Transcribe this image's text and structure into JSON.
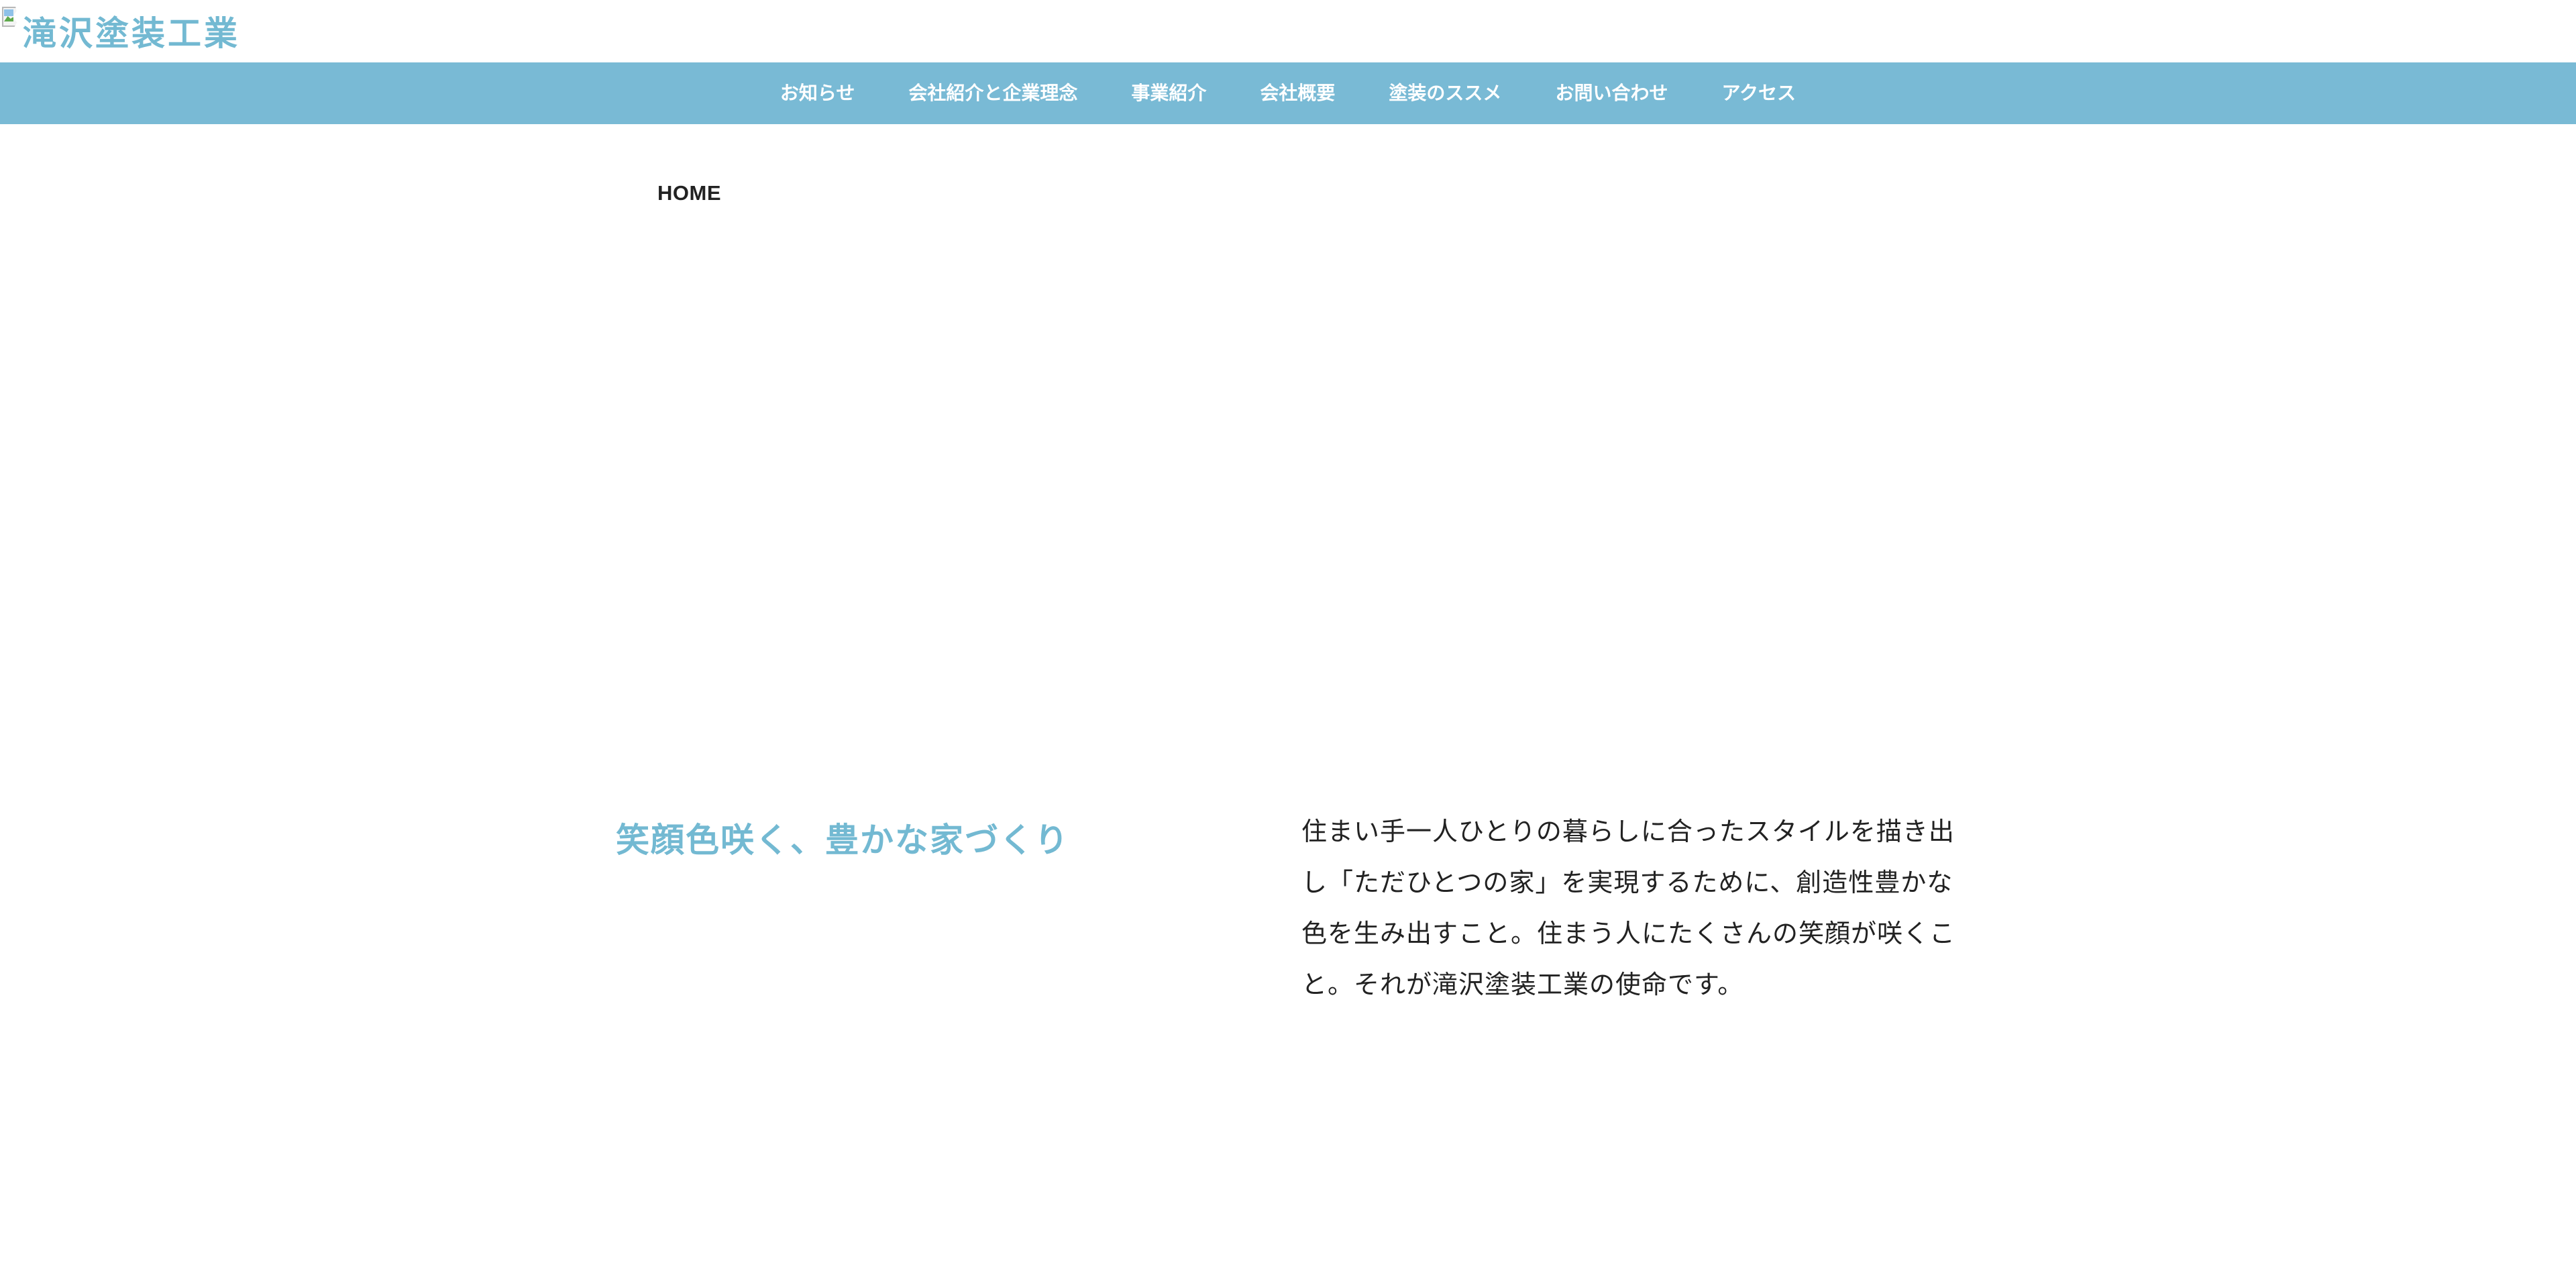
{
  "header": {
    "logo_alt_text": "滝沢塗装工業",
    "broken_image_icon": "broken-image-icon"
  },
  "nav": {
    "items": [
      {
        "label": "お知らせ"
      },
      {
        "label": "会社紹介と企業理念"
      },
      {
        "label": "事業紹介"
      },
      {
        "label": "会社概要"
      },
      {
        "label": "塗装のススメ"
      },
      {
        "label": "お問い合わせ"
      },
      {
        "label": "アクセス"
      }
    ]
  },
  "breadcrumb": {
    "home_label": "HOME"
  },
  "intro": {
    "tagline": "笑顔色咲く、豊かな家づくり",
    "mission_text": "住まい手一人ひとりの暮らしに合ったスタイルを描き出し「ただひとつの家」を実現するために、創造性豊かな色を生み出すこと。住まう人にたくさんの笑顔が咲くこと。それが滝沢塗装工業の使命です。"
  },
  "colors": {
    "accent": "#73b9d2",
    "nav_background": "#79bad5",
    "text": "#222222",
    "background": "#ffffff"
  }
}
